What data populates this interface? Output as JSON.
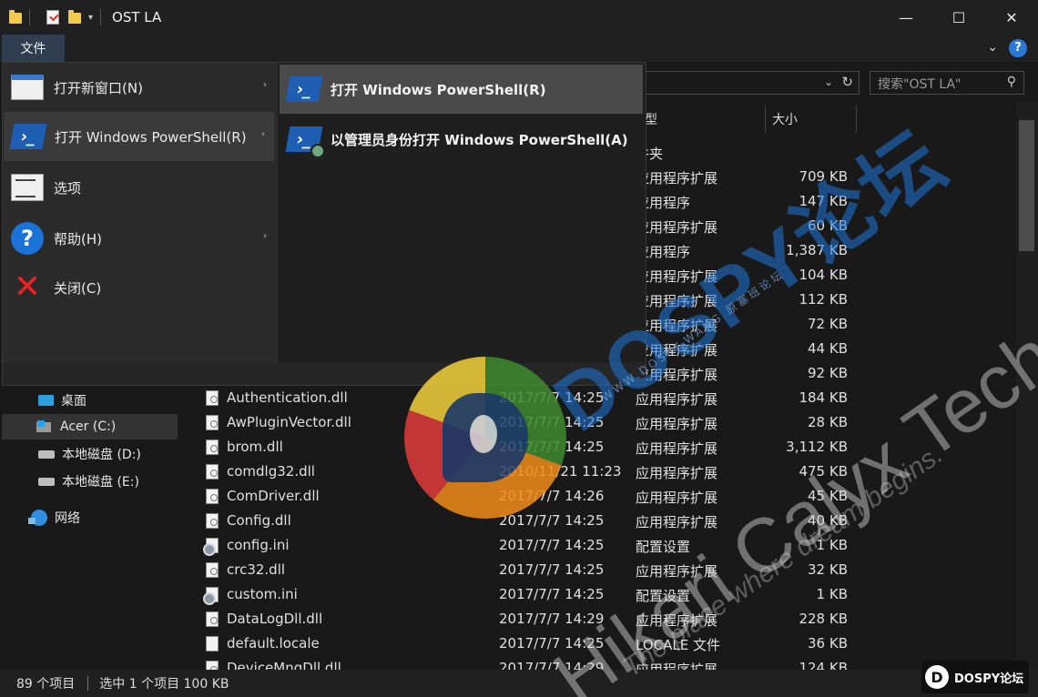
{
  "titlebar": {
    "title": "OST LA",
    "icons": [
      "folder-icon",
      "properties-check-icon",
      "new-folder-icon",
      "customize-dropdown-icon"
    ],
    "controls": {
      "minimize": "—",
      "maximize": "☐",
      "close": "✕"
    }
  },
  "ribbon": {
    "file_tab": "文件",
    "expand_glyph": "⌄",
    "help_glyph": "?"
  },
  "address": {
    "chevron": "⌄",
    "refresh": "↻",
    "search_placeholder": "搜索\"OST LA\"",
    "search_glyph": "⚲"
  },
  "file_menu": {
    "items": [
      {
        "label": "打开新窗口(N)",
        "icon": "new-window-icon",
        "has_submenu": true
      },
      {
        "label": "打开 Windows PowerShell(R)",
        "icon": "powershell-icon",
        "has_submenu": true
      },
      {
        "label": "选项",
        "icon": "options-icon",
        "has_submenu": false
      },
      {
        "label": "帮助(H)",
        "icon": "help-icon",
        "has_submenu": true
      },
      {
        "label": "关闭(C)",
        "icon": "close-icon",
        "has_submenu": false
      }
    ],
    "submenu": [
      {
        "label": "打开 Windows PowerShell(R)",
        "icon": "powershell-icon"
      },
      {
        "label": "以管理员身份打开 Windows PowerShell(A)",
        "icon": "powershell-admin-icon"
      }
    ],
    "arrow": "›",
    "ps_glyph": "›_",
    "help_glyph": "?",
    "close_glyph": "✕"
  },
  "nav": {
    "items": [
      {
        "label": "桌面",
        "icon": "desktop-icon"
      },
      {
        "label": "Acer (C:)",
        "icon": "windows-drive-icon",
        "selected": true
      },
      {
        "label": "本地磁盘 (D:)",
        "icon": "drive-icon"
      },
      {
        "label": "本地磁盘 (E:)",
        "icon": "drive-icon"
      },
      {
        "label": "网络",
        "icon": "network-icon"
      }
    ]
  },
  "list": {
    "columns": {
      "type": "型",
      "size": "大小"
    },
    "partial_rows": [
      {
        "type": "件夹",
        "size": ""
      },
      {
        "type": "应用程序扩展",
        "size": "709 KB"
      },
      {
        "type": "应用程序",
        "size": "147 KB"
      },
      {
        "type": "应用程序扩展",
        "size": "60 KB"
      },
      {
        "type": "应用程序",
        "size": "1,387 KB"
      },
      {
        "type": "应用程序扩展",
        "size": "104 KB"
      },
      {
        "type": "应用程序扩展",
        "size": "112 KB"
      },
      {
        "type": "应用程序扩展",
        "size": "72 KB"
      },
      {
        "type": "应用程序扩展",
        "size": "44 KB"
      },
      {
        "type": "应用程序扩展",
        "size": "92 KB"
      }
    ],
    "rows": [
      {
        "name": "Authentication.dll",
        "date": "2017/7/7 14:25",
        "type": "应用程序扩展",
        "size": "184 KB",
        "icon": "dll-file-icon"
      },
      {
        "name": "AwPluginVector.dll",
        "date": "2017/7/7 14:25",
        "type": "应用程序扩展",
        "size": "28 KB",
        "icon": "dll-file-icon"
      },
      {
        "name": "brom.dll",
        "date": "2017/7/7 14:25",
        "type": "应用程序扩展",
        "size": "3,112 KB",
        "icon": "dll-file-icon"
      },
      {
        "name": "comdlg32.dll",
        "date": "2010/11/21 11:23",
        "type": "应用程序扩展",
        "size": "475 KB",
        "icon": "dll-file-icon"
      },
      {
        "name": "ComDriver.dll",
        "date": "2017/7/7 14:26",
        "type": "应用程序扩展",
        "size": "45 KB",
        "icon": "dll-file-icon"
      },
      {
        "name": "Config.dll",
        "date": "2017/7/7 14:25",
        "type": "应用程序扩展",
        "size": "40 KB",
        "icon": "dll-file-icon"
      },
      {
        "name": "config.ini",
        "date": "2017/7/7 14:25",
        "type": "配置设置",
        "size": "1 KB",
        "icon": "ini-file-icon"
      },
      {
        "name": "crc32.dll",
        "date": "2017/7/7 14:25",
        "type": "应用程序扩展",
        "size": "32 KB",
        "icon": "dll-file-icon"
      },
      {
        "name": "custom.ini",
        "date": "2017/7/7 14:25",
        "type": "配置设置",
        "size": "1 KB",
        "icon": "ini-file-icon"
      },
      {
        "name": "DataLogDll.dll",
        "date": "2017/7/7 14:29",
        "type": "应用程序扩展",
        "size": "228 KB",
        "icon": "dll-file-icon"
      },
      {
        "name": "default.locale",
        "date": "2017/7/7 14:25",
        "type": "LOCALE 文件",
        "size": "36 KB",
        "icon": "file-icon"
      },
      {
        "name": "DeviceMngDll.dll",
        "date": "2017/7/7 14:29",
        "type": "应用程序扩展",
        "size": "124 KB",
        "icon": "dll-file-icon"
      }
    ]
  },
  "statusbar": {
    "count": "89 个项目",
    "selection": "选中 1 个项目  100 KB"
  },
  "watermarks": {
    "dospy": "DOSPY论坛",
    "dospy_sub": "WWW.DOSPY.WANG 原塞班论坛",
    "tech": "Hikari Calyx Tech",
    "tagline": "The place where dream begins.",
    "badge": "DOSPY论坛",
    "badge_letter": "D"
  }
}
